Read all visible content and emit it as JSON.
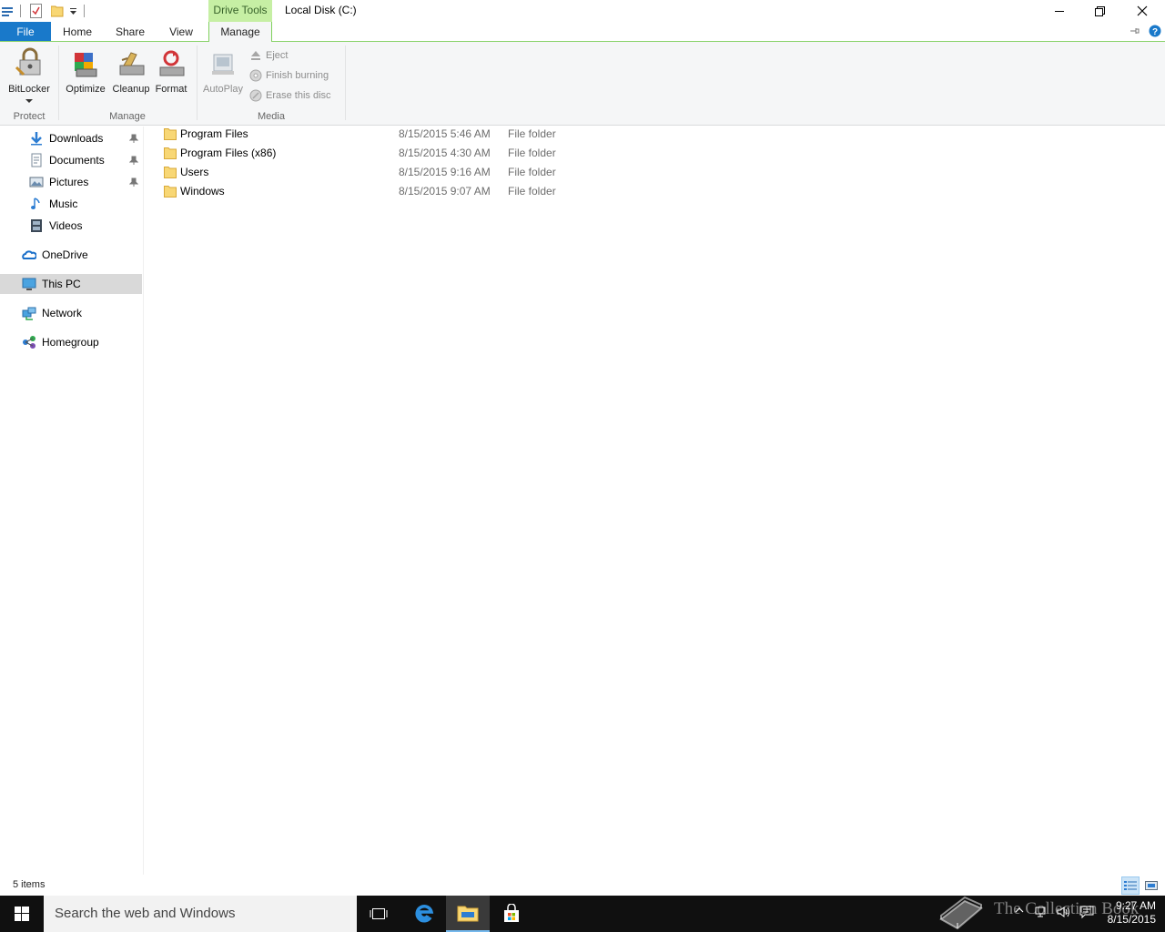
{
  "titlebar": {
    "context_tab": "Drive Tools",
    "window_title": "Local Disk (C:)"
  },
  "tabs": {
    "file": "File",
    "home": "Home",
    "share": "Share",
    "view": "View",
    "manage": "Manage"
  },
  "ribbon": {
    "protect": {
      "label": "Protect",
      "bitlocker": "BitLocker"
    },
    "manage": {
      "label": "Manage",
      "optimize": "Optimize",
      "cleanup": "Cleanup",
      "format": "Format"
    },
    "media": {
      "label": "Media",
      "autoplay": "AutoPlay",
      "eject": "Eject",
      "finish_burning": "Finish burning",
      "erase_disc": "Erase this disc"
    }
  },
  "navpane": {
    "items": [
      {
        "label": "Downloads",
        "icon": "downloads-icon",
        "pinned": true
      },
      {
        "label": "Documents",
        "icon": "documents-icon",
        "pinned": true
      },
      {
        "label": "Pictures",
        "icon": "pictures-icon",
        "pinned": true
      },
      {
        "label": "Music",
        "icon": "music-icon",
        "pinned": false
      },
      {
        "label": "Videos",
        "icon": "videos-icon",
        "pinned": false
      },
      {
        "label": "OneDrive",
        "icon": "onedrive-icon",
        "pinned": false
      },
      {
        "label": "This PC",
        "icon": "this-pc-icon",
        "pinned": false,
        "selected": true
      },
      {
        "label": "Network",
        "icon": "network-icon",
        "pinned": false
      },
      {
        "label": "Homegroup",
        "icon": "homegroup-icon",
        "pinned": false
      }
    ]
  },
  "files": [
    {
      "name": "Program Files",
      "date": "8/15/2015 5:46 AM",
      "type": "File folder"
    },
    {
      "name": "Program Files (x86)",
      "date": "8/15/2015 4:30 AM",
      "type": "File folder"
    },
    {
      "name": "Users",
      "date": "8/15/2015 9:16 AM",
      "type": "File folder"
    },
    {
      "name": "Windows",
      "date": "8/15/2015 9:07 AM",
      "type": "File folder"
    }
  ],
  "status": {
    "count": "5 items"
  },
  "taskbar": {
    "search_placeholder": "Search the web and Windows",
    "time": "9:27 AM",
    "date": "8/15/2015",
    "watermark": "The Collection Book"
  },
  "colors": {
    "file_tab": "#1979ca",
    "drive_tools": "#c6efa4",
    "taskbar": "#101010",
    "accent": "#76b9ed"
  }
}
